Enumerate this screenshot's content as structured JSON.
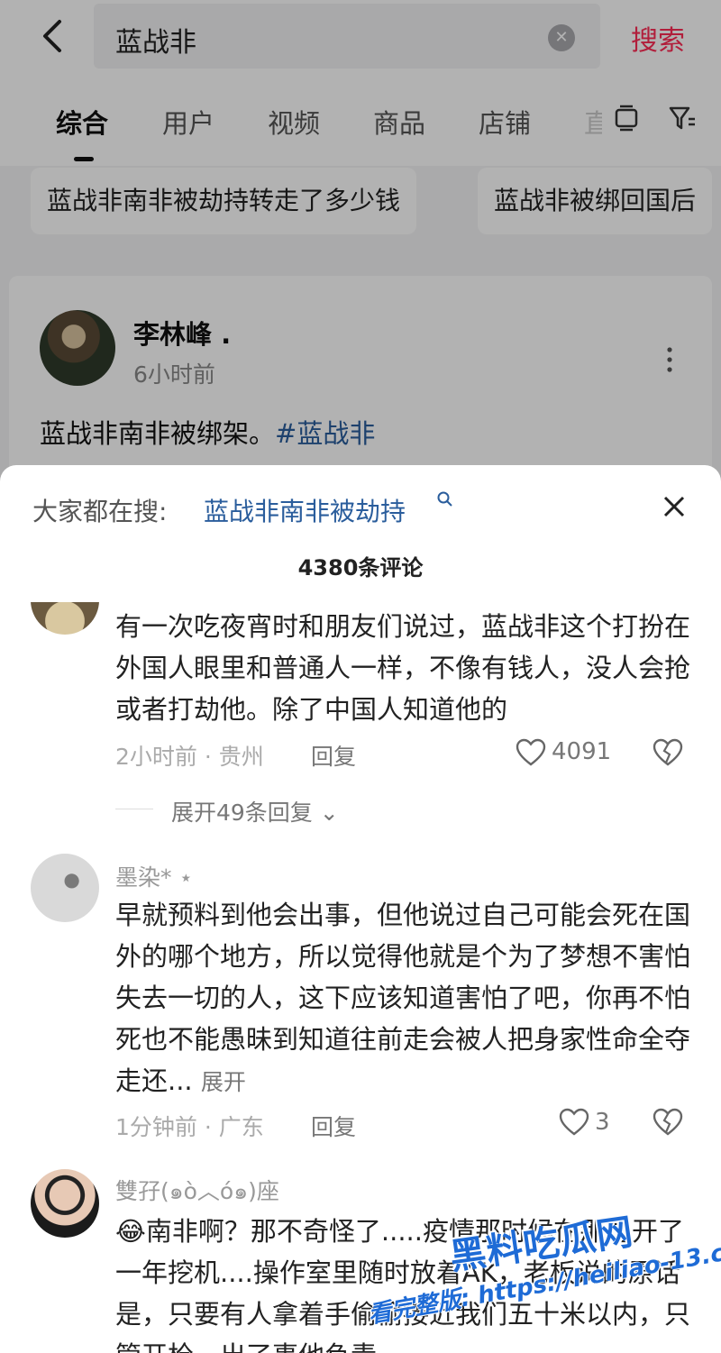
{
  "search": {
    "query": "蓝战非",
    "button_label": "搜索"
  },
  "tabs": [
    {
      "label": "综合"
    },
    {
      "label": "用户"
    },
    {
      "label": "视频"
    },
    {
      "label": "商品"
    },
    {
      "label": "店铺"
    },
    {
      "label": "直"
    }
  ],
  "suggestions": [
    "蓝战非南非被劫持转走了多少钱",
    "蓝战非被绑回国后"
  ],
  "post": {
    "username": "李林峰 .",
    "time": "6小时前",
    "text": "蓝战非南非被绑架。",
    "hashtag": "#蓝战非"
  },
  "sheet": {
    "hot_label": "大家都在搜:",
    "hot_link": "蓝战非南非被劫持",
    "comment_count": "4380条评论"
  },
  "comments": [
    {
      "username": "",
      "text": "有一次吃夜宵时和朋友们说过，蓝战非这个打扮在外国人眼里和普通人一样，不像有钱人，没人会抢或者打劫他。除了中国人知道他的",
      "meta": "2小时前 · 贵州",
      "reply_label": "回复",
      "likes": "4091",
      "expand_replies": "展开49条回复"
    },
    {
      "username": "墨染* ⋆",
      "text": "早就预料到他会出事，但他说过自己可能会死在国外的哪个地方，所以觉得他就是个为了梦想不害怕失去一切的人，这下应该知道害怕了吧，你再不怕死也不能愚昧到知道往前走会被人把身家性命全夺走还...",
      "expand_label": "展开",
      "meta": "1分钟前 · 广东",
      "reply_label": "回复",
      "likes": "3"
    },
    {
      "username": "雙孖(๑ò︿ó๑)座",
      "text": "😂南非啊？那不奇怪了.....疫情那时候在那边开了一年挖机....操作室里随时放着AK，老板说的原话是，只要有人拿着手偷偷接近我们五十米以内，只管开枪，出了事他负责"
    }
  ],
  "watermark": {
    "main": "黑料吃瓜网",
    "url": "看完整版: https://heiliao-13.com"
  },
  "colors": {
    "accent": "#fe2c55",
    "link": "#2a5d9c",
    "watermark": "#1e6bd6"
  }
}
